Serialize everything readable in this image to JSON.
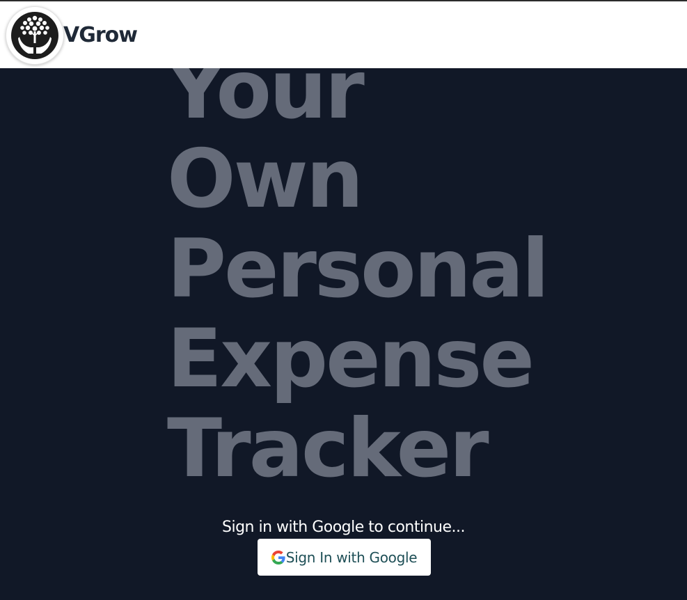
{
  "navbar": {
    "brand": "VGrow",
    "logo_icon": "money-tree-hands-icon"
  },
  "hero": {
    "lines": [
      "Your",
      "Own",
      "Personal",
      "Expense",
      "Tracker"
    ]
  },
  "signin": {
    "prompt": "Sign in with Google to continue...",
    "button_label": "Sign In with Google",
    "button_icon": "google-icon"
  },
  "colors": {
    "background": "#111827",
    "hero_text": "#656b79",
    "navbar": "#ffffff",
    "brand_text": "#1f2937",
    "button_text": "#1e4f56"
  }
}
